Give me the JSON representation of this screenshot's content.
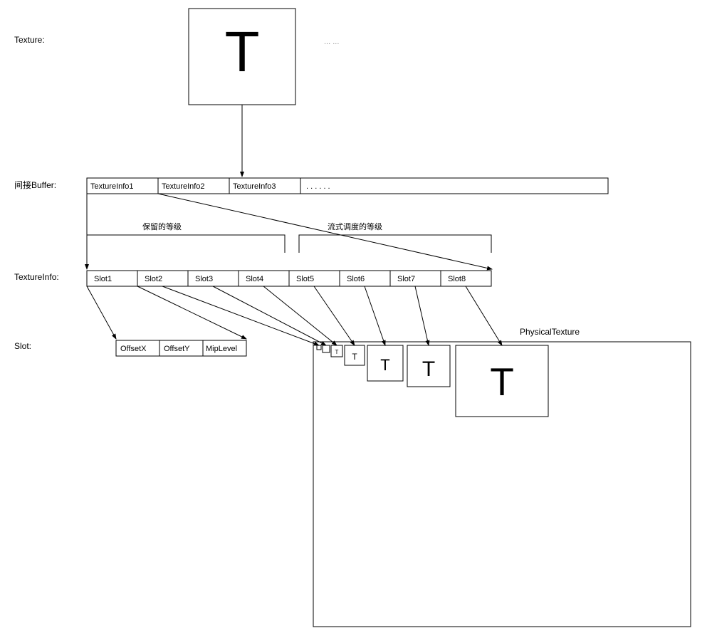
{
  "labels": {
    "texture": "Texture:",
    "indirect_buffer": "间接Buffer:",
    "textureinfo": "TextureInfo:",
    "slot": "Slot:",
    "physical_texture": "PhysicalTexture",
    "reserved_levels": "保留的等级",
    "streaming_levels": "流式调度的等级",
    "ellipsis_small": "... ...",
    "big_T": "T"
  },
  "buffer_cells": [
    "TextureInfo1",
    "TextureInfo2",
    "TextureInfo3",
    ". . . . . ."
  ],
  "textureinfo_slots": [
    "Slot1",
    "Slot2",
    "Slot3",
    "Slot4",
    "Slot5",
    "Slot6",
    "Slot7",
    "Slot8"
  ],
  "slot_fields": [
    "OffsetX",
    "OffsetY",
    "MipLevel"
  ],
  "mip_glyph": "T"
}
